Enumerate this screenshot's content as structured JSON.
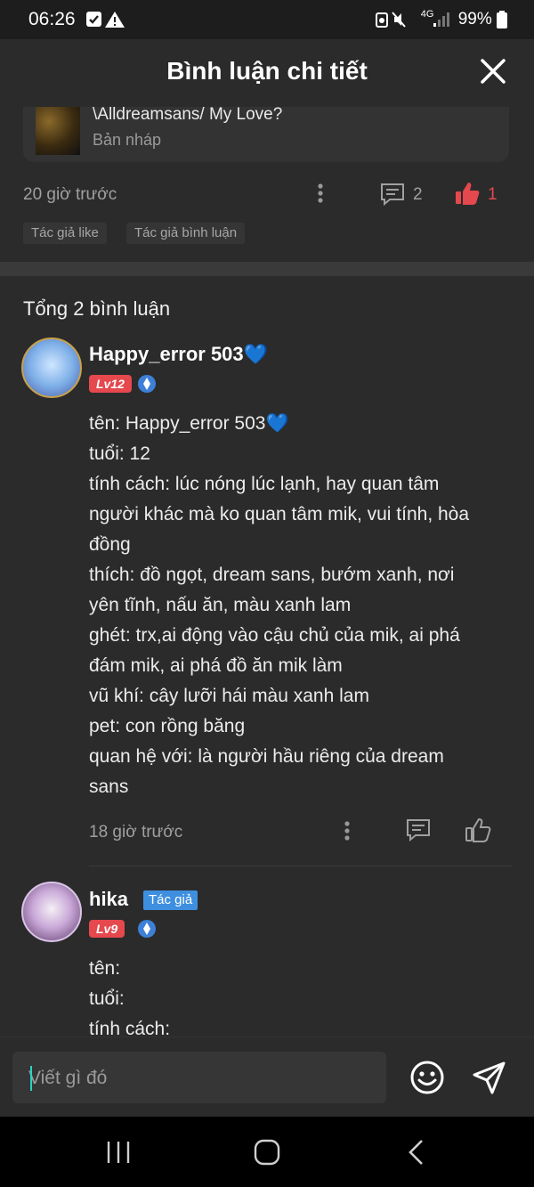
{
  "status_bar": {
    "time": "06:26",
    "left_icons": [
      "checkbox-icon",
      "warning-icon"
    ],
    "network": "4G",
    "battery": "99%"
  },
  "header": {
    "title": "Bình luận chi tiết"
  },
  "post": {
    "title": "\\Alldreamsans/ My Love?",
    "status": "Bản nháp",
    "time": "20 giờ trước",
    "comment_count": "2",
    "like_count": "1",
    "tags": [
      "Tác giả like",
      "Tác giả bình luận"
    ]
  },
  "comments_total": "Tổng 2 bình luận",
  "comments": [
    {
      "username": "Happy_error 503💙",
      "level": "Lv12",
      "lines": [
        "tên: Happy_error 503💙",
        "tuổi: 12",
        "tính cách: lúc nóng lúc lạnh, hay quan tâm",
        "người khác mà ko quan tâm mik, vui tính, hòa",
        "đồng",
        "thích: đồ ngọt, dream sans, bướm xanh, nơi",
        "yên tĩnh, nấu ăn, màu xanh lam",
        "ghét: trx,ai động vào cậu chủ của mik, ai phá",
        "đám mik, ai phá đồ ăn mik làm",
        "vũ khí: cây lưỡi hái màu xanh lam",
        "pet: con rồng băng",
        "quan hệ với: là người hầu riêng của dream",
        "sans"
      ],
      "time": "18 giờ trước"
    },
    {
      "username": "hika",
      "author_tag": "Tác giả",
      "level": "Lv9",
      "lines": [
        "tên:",
        "tuổi:",
        "tính cách:"
      ]
    }
  ],
  "input": {
    "placeholder": "Viết gì đó"
  },
  "colors": {
    "accent_red": "#e5484d",
    "author_blue": "#3e8fe0",
    "cursor_teal": "#2bd3c2"
  }
}
